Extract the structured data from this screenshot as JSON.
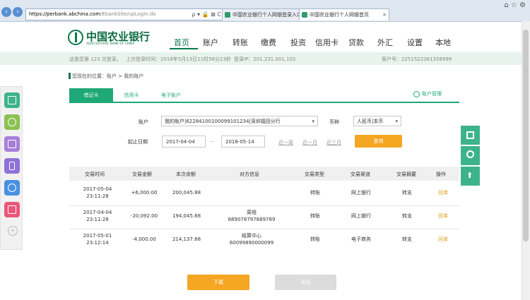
{
  "browser": {
    "url_scheme": "https://",
    "url_host": "perbank.abchina.com",
    "url_path": "/EbankSite/upLogin.do",
    "url_icons": "ρ ▾ 🔒 ⊠ C",
    "tabs": [
      {
        "label": "中国农业银行个人网银登录入口",
        "active": false
      },
      {
        "label": "中国农业银行个人网银首页",
        "active": true
      }
    ],
    "tab_close": "×",
    "window_icons": "⌂ ☆ ⚙"
  },
  "header": {
    "logo_cn": "中国农业银行",
    "logo_en": "AGRICULTURAL BANK OF CHINA",
    "nav": [
      "首页",
      "账户",
      "转账",
      "缴费",
      "投资",
      "信用卡",
      "贷款",
      "外汇",
      "设置",
      "本地"
    ],
    "active_nav": "首页"
  },
  "infobar": {
    "login_count": "这是您第 123 次登录，",
    "last_login_time": "上次登录时间：2018年5月13日11时58分23秒",
    "login_ip": "登录IP：201.231.001.102",
    "customer_no": "客户号：2251522361358999"
  },
  "breadcrumb": "您现在的位置：账户 > 我的账户",
  "subtabs": [
    "借记卡",
    "信用卡",
    "电子账户"
  ],
  "account_mgmt": "账户管理",
  "form": {
    "account_label": "账户",
    "account_value": "我的账户|6228410010009910123​4|深圳福田分行",
    "currency_label": "币种",
    "currency_value": "人民币|本币",
    "date_label": "起止日期",
    "start_date": "2017-04-04",
    "date_sep": "—",
    "end_date": "2018-05-14",
    "quick_ranges": [
      "近一周",
      "近一月",
      "近三月"
    ],
    "query_button": "查询"
  },
  "table": {
    "headers": [
      "交易时间",
      "交易金额",
      "本次余额",
      "对方信息",
      "交易类型",
      "交易渠道",
      "交易摘要",
      "操作"
    ],
    "rows": [
      {
        "date": "2017-05-04",
        "time": "23:11:28",
        "amount": "+6,000.00",
        "balance": "200,045.88",
        "party_name": "",
        "party_no": "",
        "type": "转账",
        "channel": "网上银行",
        "summary": "转支",
        "action": "回单"
      },
      {
        "date": "2017-04-04",
        "time": "23:11:28",
        "amount": "-20,092.00",
        "balance": "194,045.88",
        "party_name": "周祖",
        "party_no": "689078797889789",
        "type": "转账",
        "channel": "网上银行",
        "summary": "转支",
        "action": "回单"
      },
      {
        "date": "2017-05-01",
        "time": "23:12:14",
        "amount": "-4,000.00",
        "balance": "214,137.88",
        "party_name": "结算中心",
        "party_no": "60099890000099",
        "type": "转账",
        "channel": "电子商务",
        "summary": "转支",
        "action": "回单"
      }
    ]
  },
  "buttons": {
    "download": "下载",
    "back": "返回"
  },
  "colors": {
    "brand_green": "#0a7a4a",
    "tab_green": "#1ea877",
    "orange": "#f5a623"
  },
  "left_sidebar_icons": [
    "card-icon",
    "yen-icon",
    "chart-icon",
    "phone-icon",
    "tools-icon",
    "graph-icon",
    "add-icon"
  ],
  "right_sidebar_icons": [
    "qr-code-icon",
    "service-icon",
    "back-to-top-icon"
  ]
}
